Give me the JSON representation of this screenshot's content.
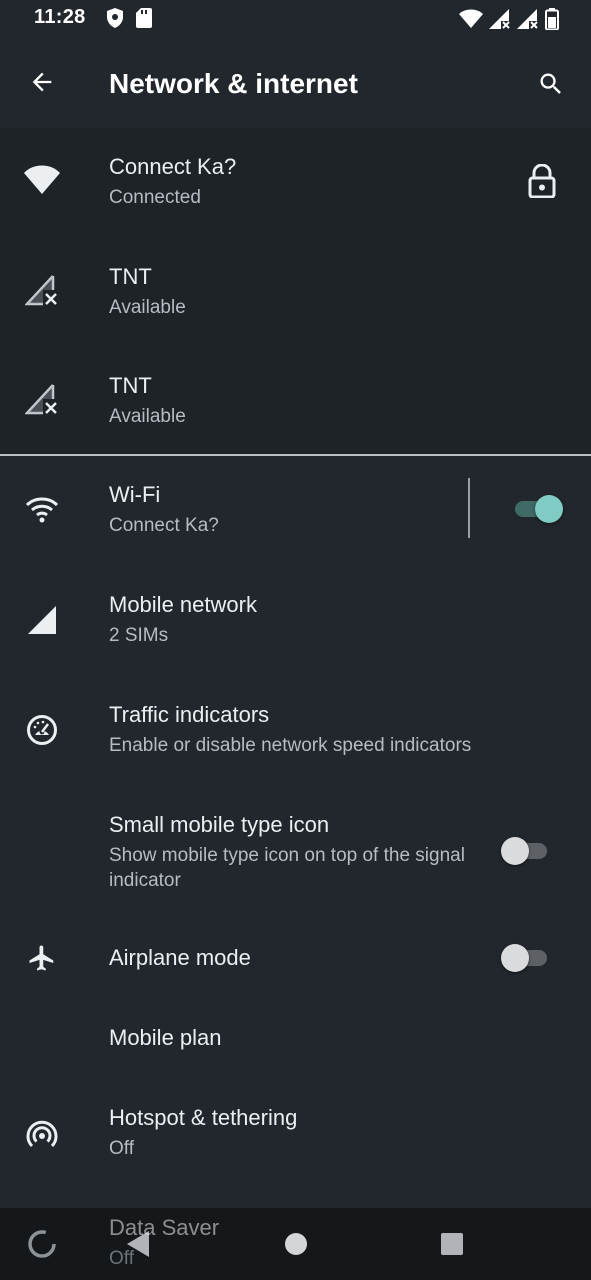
{
  "status_bar": {
    "time": "11:28",
    "left_icons": [
      "shield-icon",
      "sd-card-icon"
    ],
    "right_icons": [
      "wifi-status-icon",
      "signal-x-icon",
      "signal-x-icon",
      "battery-icon"
    ]
  },
  "app_bar": {
    "title": "Network & internet",
    "back_icon": "arrow-back-icon",
    "search_icon": "search-icon"
  },
  "networks": [
    {
      "name": "Connect Ka?",
      "status": "Connected",
      "icon": "wifi-full-icon",
      "secured": true
    },
    {
      "name": "TNT",
      "status": "Available",
      "icon": "signal-no-service-icon",
      "secured": false
    },
    {
      "name": "TNT",
      "status": "Available",
      "icon": "signal-no-service-icon",
      "secured": false
    }
  ],
  "settings": {
    "wifi": {
      "title": "Wi-Fi",
      "subtitle": "Connect Ka?",
      "enabled": true
    },
    "mobile_network": {
      "title": "Mobile network",
      "subtitle": "2 SIMs"
    },
    "traffic_indicators": {
      "title": "Traffic indicators",
      "subtitle": "Enable or disable network speed indicators"
    },
    "small_mobile_type_icon": {
      "title": "Small mobile type icon",
      "subtitle": "Show mobile type icon on top of the signal indicator",
      "enabled": false
    },
    "airplane_mode": {
      "title": "Airplane mode",
      "enabled": false
    },
    "mobile_plan": {
      "title": "Mobile plan"
    },
    "hotspot": {
      "title": "Hotspot & tethering",
      "subtitle": "Off"
    },
    "data_saver": {
      "title": "Data Saver",
      "subtitle": "Off"
    }
  },
  "colors": {
    "background": "#22272d",
    "network_section": "#1e2328",
    "accent": "#80cbc4",
    "text_primary": "#eceff1",
    "text_secondary": "#b6bcc2",
    "nav_bar": "#15181b"
  }
}
